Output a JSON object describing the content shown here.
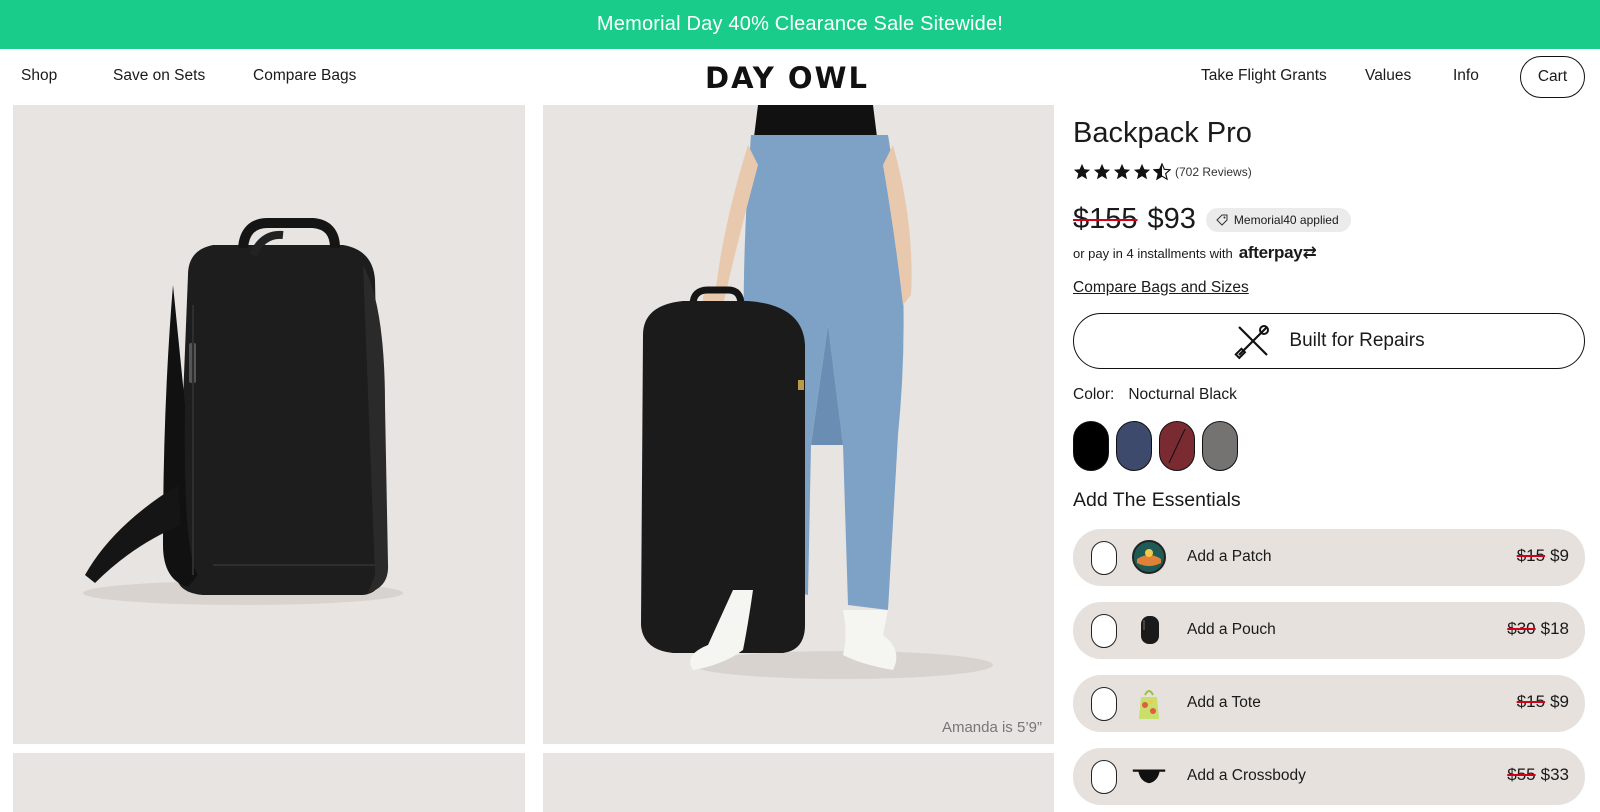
{
  "promo_bar": {
    "text": "Memorial Day 40% Clearance Sale Sitewide!"
  },
  "nav": {
    "left": [
      "Shop",
      "Save on Sets",
      "Compare Bags"
    ],
    "logo": "DAY OWL",
    "right": [
      "Take Flight Grants",
      "Values",
      "Info"
    ],
    "cart": "Cart"
  },
  "gallery": {
    "caption": "Amanda is 5’9”"
  },
  "product": {
    "title": "Backpack Pro",
    "rating": 4.5,
    "reviews": "(702 Reviews)",
    "old_price": "$155",
    "new_price": "$93",
    "promo_badge": "Memorial40 applied",
    "afterpay_text": "or pay in 4 installments with",
    "afterpay_brand": "afterpay",
    "compare_link": "Compare Bags and Sizes",
    "repairs_button": "Built for Repairs",
    "color_label": "Color:",
    "color_value": "Nocturnal Black",
    "swatches": [
      {
        "name": "Nocturnal Black",
        "color": "#000000",
        "selected": true
      },
      {
        "name": "navy",
        "color": "#3d4a6b"
      },
      {
        "name": "maroon",
        "color": "#7a2a31",
        "sold_out": true
      },
      {
        "name": "gray",
        "color": "#757272"
      }
    ]
  },
  "essentials": {
    "title": "Add The Essentials",
    "items": [
      {
        "label": "Add a Patch",
        "was": "$15",
        "now": "$9"
      },
      {
        "label": "Add a Pouch",
        "was": "$30",
        "now": "$18"
      },
      {
        "label": "Add a Tote",
        "was": "$15",
        "now": "$9"
      },
      {
        "label": "Add a Crossbody",
        "was": "$55",
        "now": "$33"
      }
    ]
  },
  "colors": {
    "promo_green": "#19cc8a",
    "strike_red": "#d0021b",
    "addon_bg": "#e6e1dd"
  }
}
